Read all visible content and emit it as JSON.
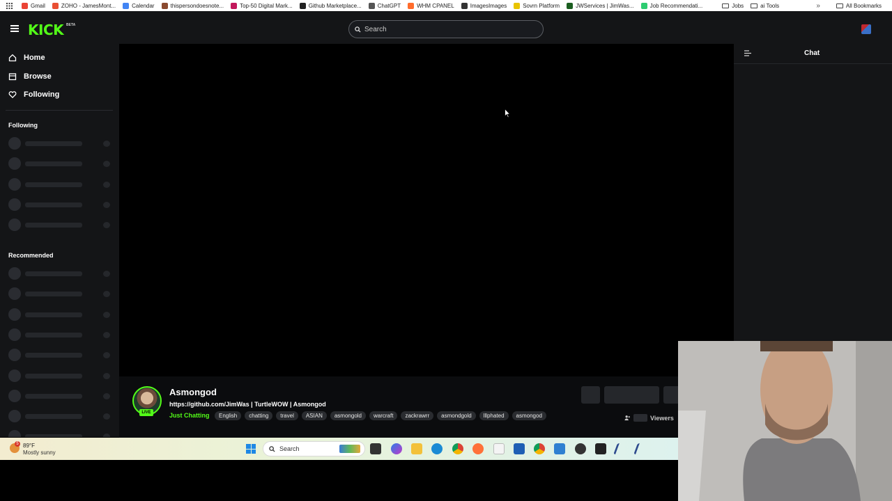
{
  "bookmarks": {
    "items": [
      {
        "label": "Gmail",
        "color": "#ea4335"
      },
      {
        "label": "ZOHO - JamesMont...",
        "color": "#e94f33"
      },
      {
        "label": "Calendar",
        "color": "#4285f4"
      },
      {
        "label": "thispersondoesnote...",
        "color": "#8a4a2f"
      },
      {
        "label": "Top-50 Digital Mark...",
        "color": "#c2185b"
      },
      {
        "label": "Github Marketplace...",
        "color": "#222222"
      },
      {
        "label": "ChatGPT",
        "color": "#555555"
      },
      {
        "label": "WHM CPANEL",
        "color": "#ff6c2c"
      },
      {
        "label": "ImagesImages",
        "color": "#333333"
      },
      {
        "label": "Sovrn Platform",
        "color": "#e9c400"
      },
      {
        "label": "JWServices | JimWas...",
        "color": "#1b5e20"
      },
      {
        "label": "Job Recommendati...",
        "color": "#2ecc71"
      },
      {
        "label": "Jobs",
        "color": "#444444"
      },
      {
        "label": "ai Tools",
        "color": "#444444"
      }
    ],
    "overflow": "»",
    "all_bookmarks": "All Bookmarks"
  },
  "header": {
    "logo": "KICK",
    "logo_badge": "BETA",
    "search_placeholder": "Search"
  },
  "sidebar": {
    "nav": [
      {
        "label": "Home",
        "icon": "home-icon"
      },
      {
        "label": "Browse",
        "icon": "browse-icon"
      },
      {
        "label": "Following",
        "icon": "heart-icon"
      }
    ],
    "following_heading": "Following",
    "recommended_heading": "Recommended"
  },
  "stream": {
    "streamer": "Asmongod",
    "live_badge": "LIVE",
    "title": "https://github.com/JimWas | TurtleWOW | Asmongod",
    "category": "Just Chatting",
    "tags": [
      "English",
      "chatting",
      "travel",
      "ASIAN",
      "asmongold",
      "warcraft",
      "zackrawrr",
      "asmondgold",
      "lllphated",
      "asmongod"
    ],
    "viewers_label": "Viewers"
  },
  "chat": {
    "title": "Chat"
  },
  "taskbar": {
    "weather_temp": "89°F",
    "weather_desc": "Mostly sunny",
    "weather_badge": "5",
    "search_label": "Search"
  },
  "colors": {
    "accent": "#53fc18",
    "bg": "#141517"
  }
}
